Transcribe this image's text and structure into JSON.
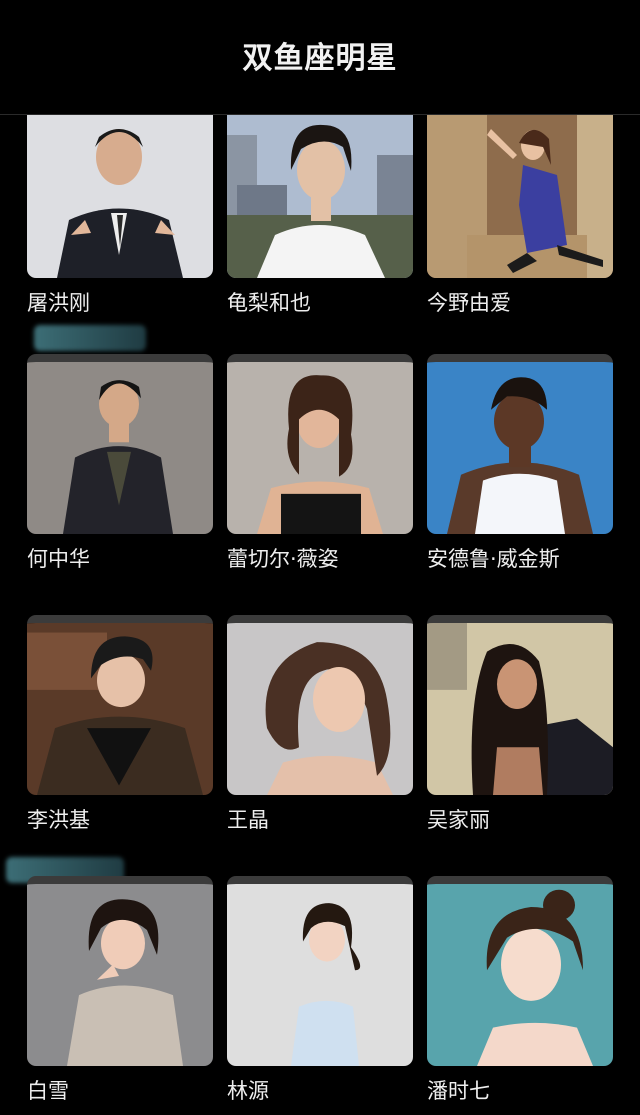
{
  "header": {
    "title": "双鱼座明星"
  },
  "celebrities": [
    {
      "name": "屠洪刚",
      "bg": "#d9dade"
    },
    {
      "name": "龟梨和也",
      "bg": "#aebdd2"
    },
    {
      "name": "今野由爱",
      "bg": "#8a6a4a"
    },
    {
      "name": "何中华",
      "bg": "#8f8a85"
    },
    {
      "name": "蕾切尔·薇姿",
      "bg": "#b9b3ad"
    },
    {
      "name": "安德鲁·威金斯",
      "bg": "#3b82c4"
    },
    {
      "name": "李洪基",
      "bg": "#5a3a28"
    },
    {
      "name": "王晶",
      "bg": "#c9c7c8"
    },
    {
      "name": "吴家丽",
      "bg": "#cfc4a4"
    },
    {
      "name": "白雪",
      "bg": "#8c8c8e"
    },
    {
      "name": "林源",
      "bg": "#dcdcdc"
    },
    {
      "name": "潘时七",
      "bg": "#5aa6ad"
    }
  ]
}
